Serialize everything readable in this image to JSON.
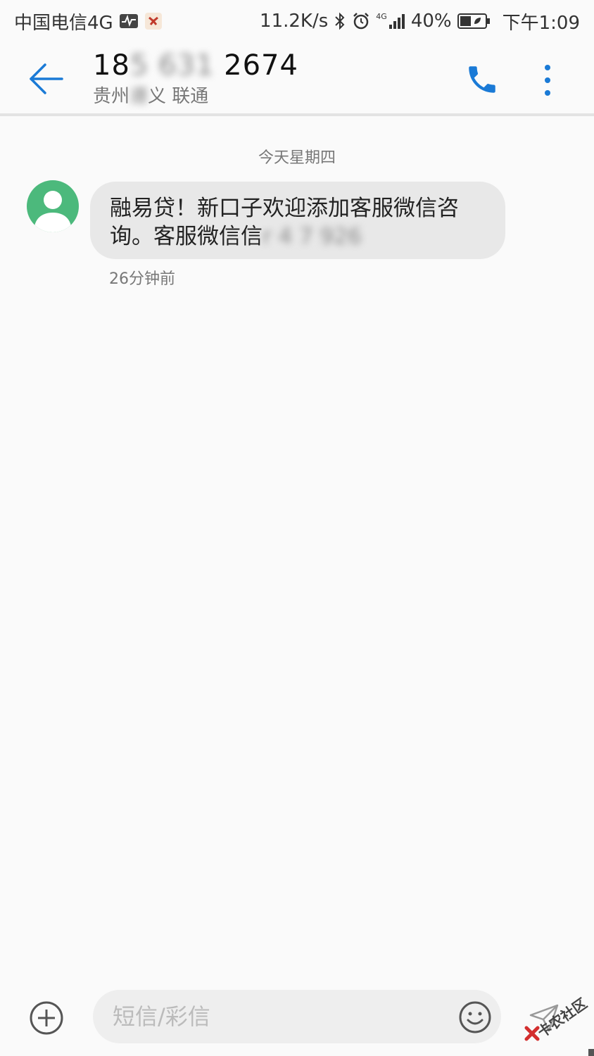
{
  "status_bar": {
    "carrier": "中国电信4G",
    "network_speed": "11.2K/s",
    "signal_type": "4G",
    "battery": "40%",
    "time": "下午1:09",
    "icons": [
      "activity-monitor-icon",
      "app-notification-icon",
      "bluetooth-icon",
      "alarm-icon",
      "signal-icon",
      "battery-icon"
    ]
  },
  "header": {
    "contact_number": "18",
    "contact_number_hidden": "5 631",
    "contact_number_tail": " 2674",
    "location_head": "贵州",
    "location_hidden": "遵",
    "location_tail": "义 联通",
    "icons": [
      "back-arrow-icon",
      "phone-icon",
      "more-vertical-icon"
    ]
  },
  "conversation": {
    "date_separator": "今天星期四",
    "messages": [
      {
        "text": "融易贷！新口子欢迎添加客服微信咨询。客服微信信",
        "hidden_text": "r  4  7   926",
        "time": "26分钟前"
      }
    ]
  },
  "composer": {
    "placeholder": "短信/彩信",
    "icons": [
      "add-circle-icon",
      "emoji-icon",
      "send-icon"
    ]
  },
  "watermark": {
    "text": "卡农社区"
  },
  "colors": {
    "accent": "#1a7ad6",
    "avatar_bg": "#4cb97c",
    "bubble_bg": "#e8e8e8",
    "background": "#fafafa"
  }
}
